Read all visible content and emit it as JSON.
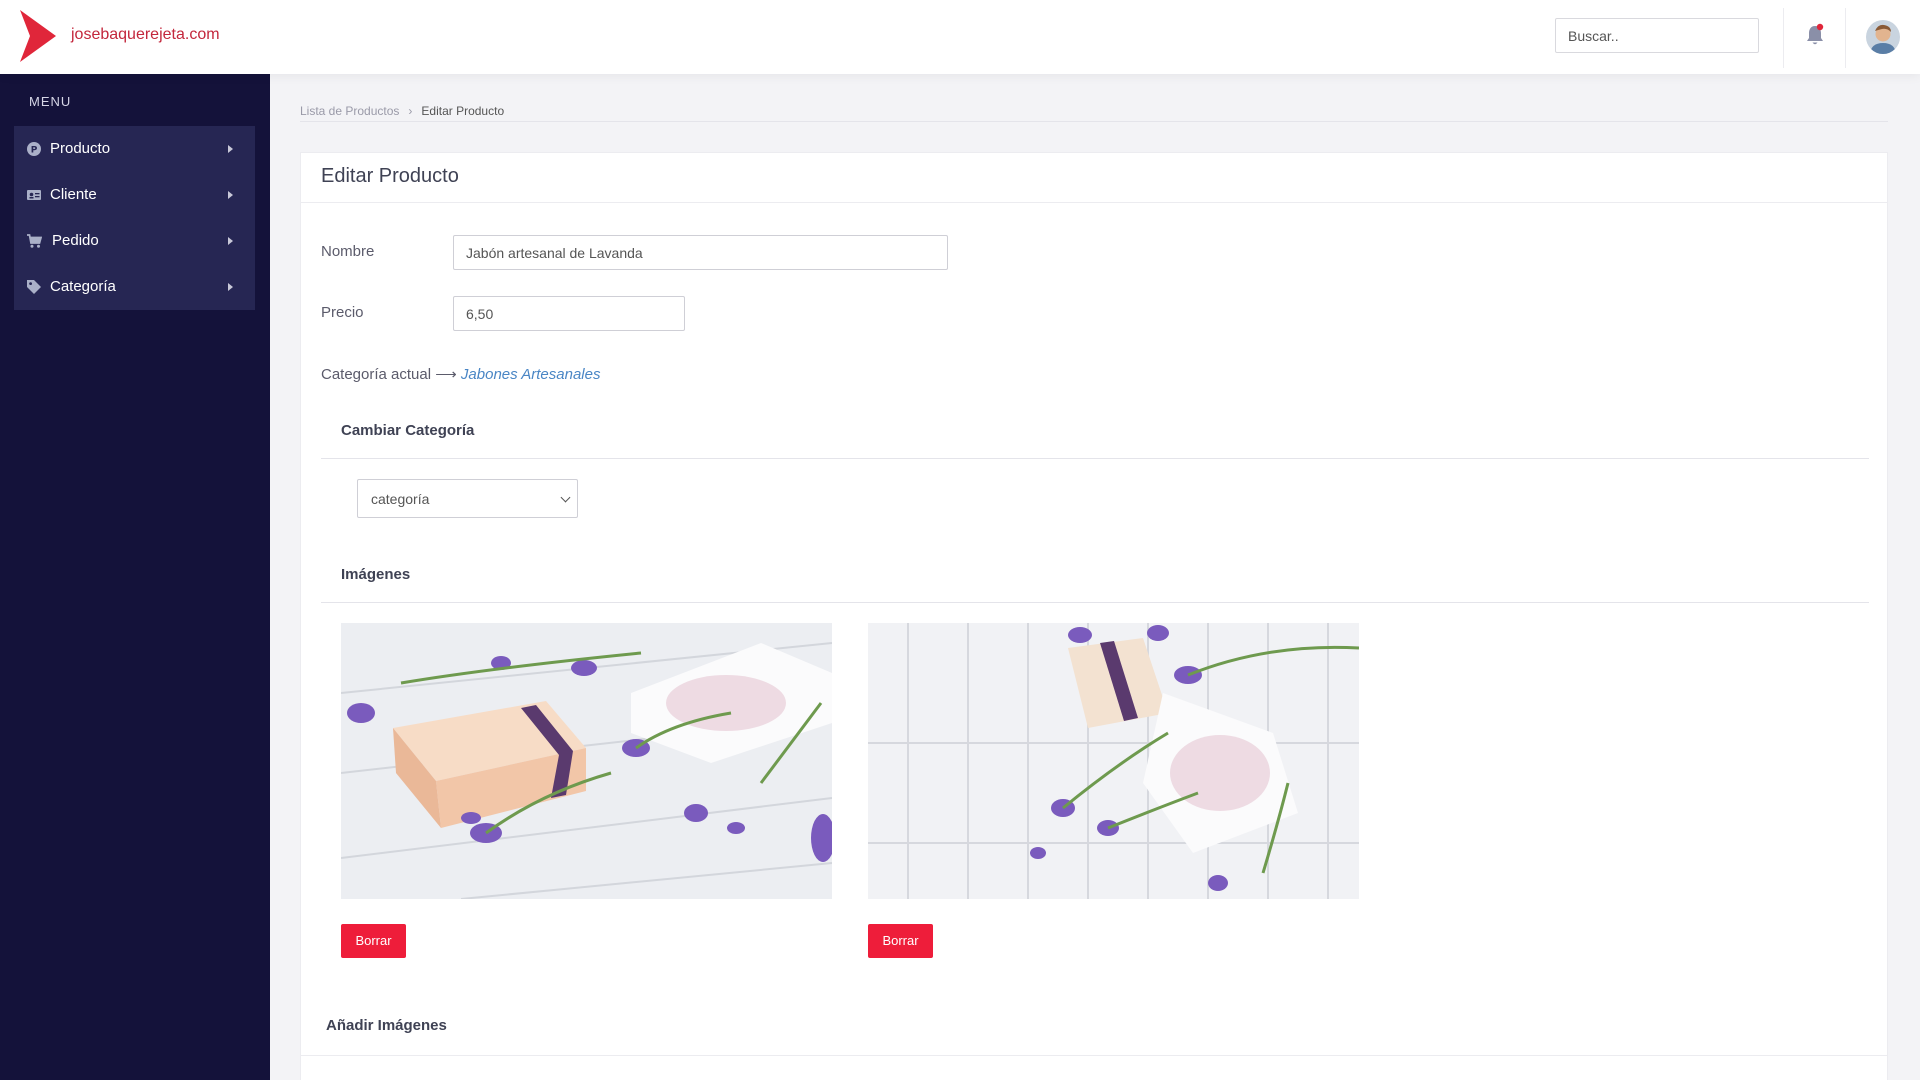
{
  "header": {
    "brand": "josebaquerejeta.com",
    "search_placeholder": "Buscar..",
    "brand_color": "#c3273c"
  },
  "sidebar": {
    "menu_title": "MENU",
    "items": [
      {
        "label": "Producto",
        "icon": "product-icon"
      },
      {
        "label": "Cliente",
        "icon": "id-card-icon"
      },
      {
        "label": "Pedido",
        "icon": "cart-icon"
      },
      {
        "label": "Categoría",
        "icon": "tag-icon"
      }
    ],
    "bg_color": "#14123a"
  },
  "breadcrumb": {
    "link": "Lista de Productos",
    "current": "Editar Producto"
  },
  "form": {
    "title": "Editar Producto",
    "nombre_label": "Nombre",
    "nombre_value": "Jabón artesanal de Lavanda",
    "precio_label": "Precio",
    "precio_value": "6,50",
    "categoria_actual_label": "Categoría actual ⟶",
    "categoria_actual_value": "Jabones Artesanales",
    "cambiar_categoria_title": "Cambiar Categoría",
    "categoria_select_value": "categoría",
    "imagenes_title": "Imágenes",
    "images": [
      {
        "alt": "lavender-soap-image-1",
        "delete_label": "Borrar"
      },
      {
        "alt": "lavender-soap-image-2",
        "delete_label": "Borrar"
      }
    ],
    "anadir_imagenes_title": "Añadir Imágenes",
    "delete_color": "#ee1d3a",
    "link_color": "#4a86c5"
  }
}
